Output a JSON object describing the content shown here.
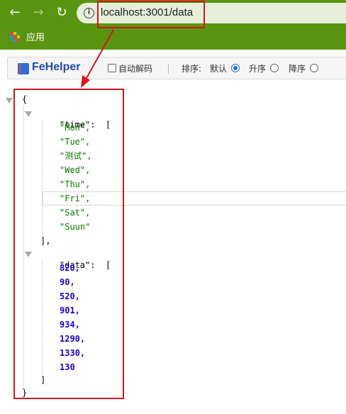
{
  "browser": {
    "url": "localhost:3001/data",
    "bookmarks_label": "应用"
  },
  "toolbar": {
    "brand": "FeHelper",
    "auto_decode_label": "自动解码",
    "sort_label": "排序:",
    "sort_options": [
      {
        "label": "默认",
        "selected": true
      },
      {
        "label": "升序",
        "selected": false
      },
      {
        "label": "降序",
        "selected": false
      }
    ]
  },
  "json": {
    "open_brace": "{",
    "close_brace": "}",
    "time_key": "\"time\"",
    "data_key": "\"data\"",
    "colon": ":",
    "open_bracket": "[",
    "close_bracket": "],",
    "close_bracket_last": "]",
    "time_values": [
      "\"Mon\",",
      "\"Tue\",",
      "\"测试\",",
      "\"Wed\",",
      "\"Thu\",",
      "\"Fri\",",
      "\"Sat\",",
      "\"Suun\""
    ],
    "data_values": [
      "820,",
      "90,",
      "520,",
      "901,",
      "934,",
      "1290,",
      "1330,",
      "130"
    ]
  },
  "colors": {
    "chrome": "#5a9511",
    "annotation": "#d6161c",
    "string": "#0b7500",
    "number": "#1a01cc"
  }
}
